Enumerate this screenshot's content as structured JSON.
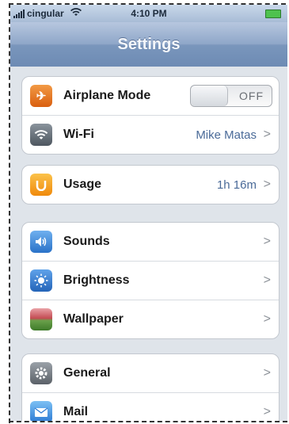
{
  "status_bar": {
    "carrier": "cingular",
    "time": "4:10 PM",
    "signal_icon": "signal-bars-icon",
    "wifi_icon": "wifi-icon",
    "battery_icon": "battery-icon"
  },
  "nav": {
    "title": "Settings"
  },
  "groups": [
    {
      "rows": [
        {
          "label": "Airplane Mode",
          "icon": "airplane-icon",
          "icon_color": "#e8741f",
          "toggle_text": "OFF"
        },
        {
          "label": "Wi-Fi",
          "icon": "wifi-icon",
          "icon_color": "#5b6570",
          "value": "Mike Matas"
        }
      ]
    },
    {
      "rows": [
        {
          "label": "Usage",
          "icon": "usage-icon",
          "icon_color": "#f4a316",
          "value": "1h 16m"
        }
      ]
    },
    {
      "rows": [
        {
          "label": "Sounds",
          "icon": "speaker-icon",
          "icon_color": "#3b86d8"
        },
        {
          "label": "Brightness",
          "icon": "sun-icon",
          "icon_color": "#3b7fd0"
        },
        {
          "label": "Wallpaper",
          "icon": "wallpaper-icon",
          "icon_color": "#5a8f3c"
        }
      ]
    },
    {
      "rows": [
        {
          "label": "General",
          "icon": "gear-icon",
          "icon_color": "#6d747c"
        },
        {
          "label": "Mail",
          "icon": "mail-icon",
          "icon_color": "#3a8ae0"
        }
      ]
    }
  ],
  "chevron": ">"
}
